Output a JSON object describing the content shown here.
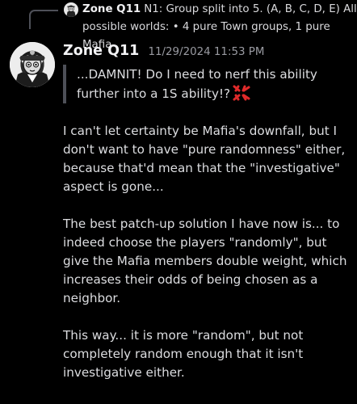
{
  "reply": {
    "author": "Zone Q11",
    "text": "N1: Group split into 5. (A, B, C, D, E)  All possible worlds: •  4 pure Town groups, 1 pure Mafia"
  },
  "message": {
    "author": "Zone Q11",
    "timestamp": "11/29/2024 11:53 PM",
    "quote": "...DAMNIT! Do I need to nerf this ability further into a 1S ability!?",
    "quote_emoji": "anger-icon",
    "paragraphs": [
      "I can't let certainty be Mafia's downfall, but I don't want to have \"pure randomness\" either, because that'd mean that the \"investigative\" aspect is gone...",
      "The best patch-up solution I have now is... to indeed choose the players \"randomly\", but give the Mafia members double weight, which increases their odds of being chosen as a neighbor.",
      "This way... it is more \"random\", but not completely random enough that it isn't investigative either."
    ]
  },
  "colors": {
    "background": "#000000",
    "text": "#dcdde0",
    "timestamp": "#9a9ba2",
    "quote_bar": "#4e5058",
    "anger_emoji": "#e02a2a"
  }
}
